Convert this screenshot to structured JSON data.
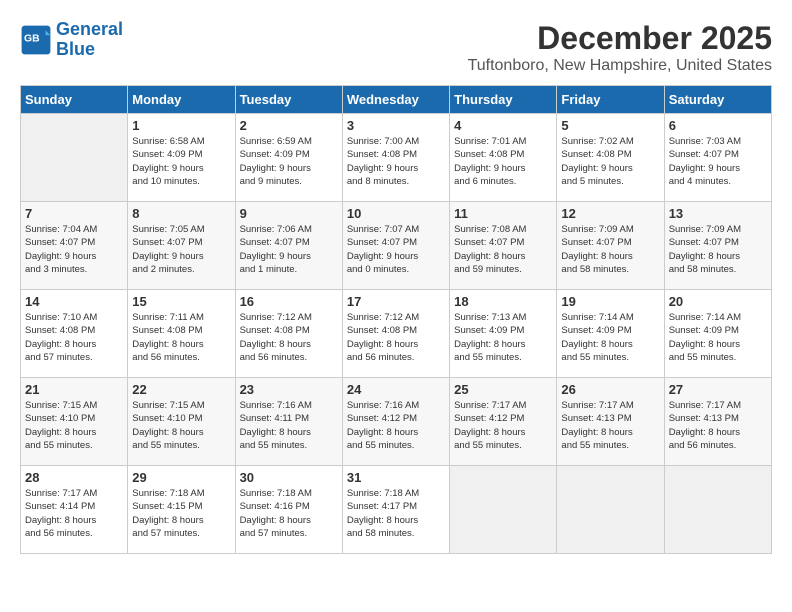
{
  "header": {
    "logo_line1": "General",
    "logo_line2": "Blue",
    "month_title": "December 2025",
    "location": "Tuftonboro, New Hampshire, United States"
  },
  "days_of_week": [
    "Sunday",
    "Monday",
    "Tuesday",
    "Wednesday",
    "Thursday",
    "Friday",
    "Saturday"
  ],
  "weeks": [
    [
      {
        "day": "",
        "info": ""
      },
      {
        "day": "1",
        "info": "Sunrise: 6:58 AM\nSunset: 4:09 PM\nDaylight: 9 hours\nand 10 minutes."
      },
      {
        "day": "2",
        "info": "Sunrise: 6:59 AM\nSunset: 4:09 PM\nDaylight: 9 hours\nand 9 minutes."
      },
      {
        "day": "3",
        "info": "Sunrise: 7:00 AM\nSunset: 4:08 PM\nDaylight: 9 hours\nand 8 minutes."
      },
      {
        "day": "4",
        "info": "Sunrise: 7:01 AM\nSunset: 4:08 PM\nDaylight: 9 hours\nand 6 minutes."
      },
      {
        "day": "5",
        "info": "Sunrise: 7:02 AM\nSunset: 4:08 PM\nDaylight: 9 hours\nand 5 minutes."
      },
      {
        "day": "6",
        "info": "Sunrise: 7:03 AM\nSunset: 4:07 PM\nDaylight: 9 hours\nand 4 minutes."
      }
    ],
    [
      {
        "day": "7",
        "info": "Sunrise: 7:04 AM\nSunset: 4:07 PM\nDaylight: 9 hours\nand 3 minutes."
      },
      {
        "day": "8",
        "info": "Sunrise: 7:05 AM\nSunset: 4:07 PM\nDaylight: 9 hours\nand 2 minutes."
      },
      {
        "day": "9",
        "info": "Sunrise: 7:06 AM\nSunset: 4:07 PM\nDaylight: 9 hours\nand 1 minute."
      },
      {
        "day": "10",
        "info": "Sunrise: 7:07 AM\nSunset: 4:07 PM\nDaylight: 9 hours\nand 0 minutes."
      },
      {
        "day": "11",
        "info": "Sunrise: 7:08 AM\nSunset: 4:07 PM\nDaylight: 8 hours\nand 59 minutes."
      },
      {
        "day": "12",
        "info": "Sunrise: 7:09 AM\nSunset: 4:07 PM\nDaylight: 8 hours\nand 58 minutes."
      },
      {
        "day": "13",
        "info": "Sunrise: 7:09 AM\nSunset: 4:07 PM\nDaylight: 8 hours\nand 58 minutes."
      }
    ],
    [
      {
        "day": "14",
        "info": "Sunrise: 7:10 AM\nSunset: 4:08 PM\nDaylight: 8 hours\nand 57 minutes."
      },
      {
        "day": "15",
        "info": "Sunrise: 7:11 AM\nSunset: 4:08 PM\nDaylight: 8 hours\nand 56 minutes."
      },
      {
        "day": "16",
        "info": "Sunrise: 7:12 AM\nSunset: 4:08 PM\nDaylight: 8 hours\nand 56 minutes."
      },
      {
        "day": "17",
        "info": "Sunrise: 7:12 AM\nSunset: 4:08 PM\nDaylight: 8 hours\nand 56 minutes."
      },
      {
        "day": "18",
        "info": "Sunrise: 7:13 AM\nSunset: 4:09 PM\nDaylight: 8 hours\nand 55 minutes."
      },
      {
        "day": "19",
        "info": "Sunrise: 7:14 AM\nSunset: 4:09 PM\nDaylight: 8 hours\nand 55 minutes."
      },
      {
        "day": "20",
        "info": "Sunrise: 7:14 AM\nSunset: 4:09 PM\nDaylight: 8 hours\nand 55 minutes."
      }
    ],
    [
      {
        "day": "21",
        "info": "Sunrise: 7:15 AM\nSunset: 4:10 PM\nDaylight: 8 hours\nand 55 minutes."
      },
      {
        "day": "22",
        "info": "Sunrise: 7:15 AM\nSunset: 4:10 PM\nDaylight: 8 hours\nand 55 minutes."
      },
      {
        "day": "23",
        "info": "Sunrise: 7:16 AM\nSunset: 4:11 PM\nDaylight: 8 hours\nand 55 minutes."
      },
      {
        "day": "24",
        "info": "Sunrise: 7:16 AM\nSunset: 4:12 PM\nDaylight: 8 hours\nand 55 minutes."
      },
      {
        "day": "25",
        "info": "Sunrise: 7:17 AM\nSunset: 4:12 PM\nDaylight: 8 hours\nand 55 minutes."
      },
      {
        "day": "26",
        "info": "Sunrise: 7:17 AM\nSunset: 4:13 PM\nDaylight: 8 hours\nand 55 minutes."
      },
      {
        "day": "27",
        "info": "Sunrise: 7:17 AM\nSunset: 4:13 PM\nDaylight: 8 hours\nand 56 minutes."
      }
    ],
    [
      {
        "day": "28",
        "info": "Sunrise: 7:17 AM\nSunset: 4:14 PM\nDaylight: 8 hours\nand 56 minutes."
      },
      {
        "day": "29",
        "info": "Sunrise: 7:18 AM\nSunset: 4:15 PM\nDaylight: 8 hours\nand 57 minutes."
      },
      {
        "day": "30",
        "info": "Sunrise: 7:18 AM\nSunset: 4:16 PM\nDaylight: 8 hours\nand 57 minutes."
      },
      {
        "day": "31",
        "info": "Sunrise: 7:18 AM\nSunset: 4:17 PM\nDaylight: 8 hours\nand 58 minutes."
      },
      {
        "day": "",
        "info": ""
      },
      {
        "day": "",
        "info": ""
      },
      {
        "day": "",
        "info": ""
      }
    ]
  ]
}
